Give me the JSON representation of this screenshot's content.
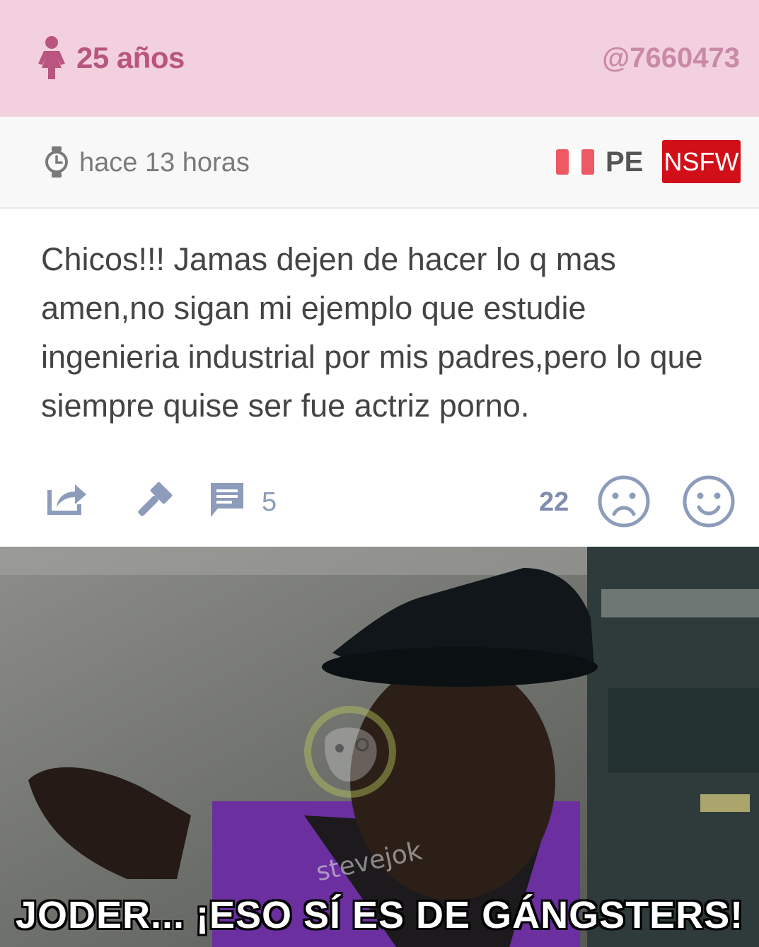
{
  "header": {
    "gender_icon": "female-icon",
    "age": "25 años",
    "user_id": "@7660473",
    "colors": {
      "background": "#f3d0dd",
      "age": "#b9557f",
      "user_id": "#c98aa7"
    }
  },
  "meta": {
    "clock_icon": "clock-icon",
    "time": "hace 13 horas",
    "flag_icon": "peru-flag-icon",
    "country": "PE",
    "nsfw_badge": "NSFW",
    "colors": {
      "badge": "#d10f18"
    }
  },
  "post": {
    "text": "Chicos!!! Jamas dejen de hacer lo q mas amen,no sigan mi ejemplo que estudie ingenieria industrial por mis padres,pero lo que siempre quise ser fue actriz porno."
  },
  "actions": {
    "share_icon": "share-icon",
    "report_icon": "gavel-icon",
    "comments_icon": "comment-icon",
    "comment_count": "5",
    "vote_count": "22",
    "sad_icon": "sad-face-icon",
    "happy_icon": "happy-face-icon",
    "colors": {
      "icon": "#8c9cba"
    }
  },
  "meme": {
    "caption": "JODER... ¡ESO SÍ ES DE GÁNGSTERS!",
    "watermark": "stevejok"
  }
}
